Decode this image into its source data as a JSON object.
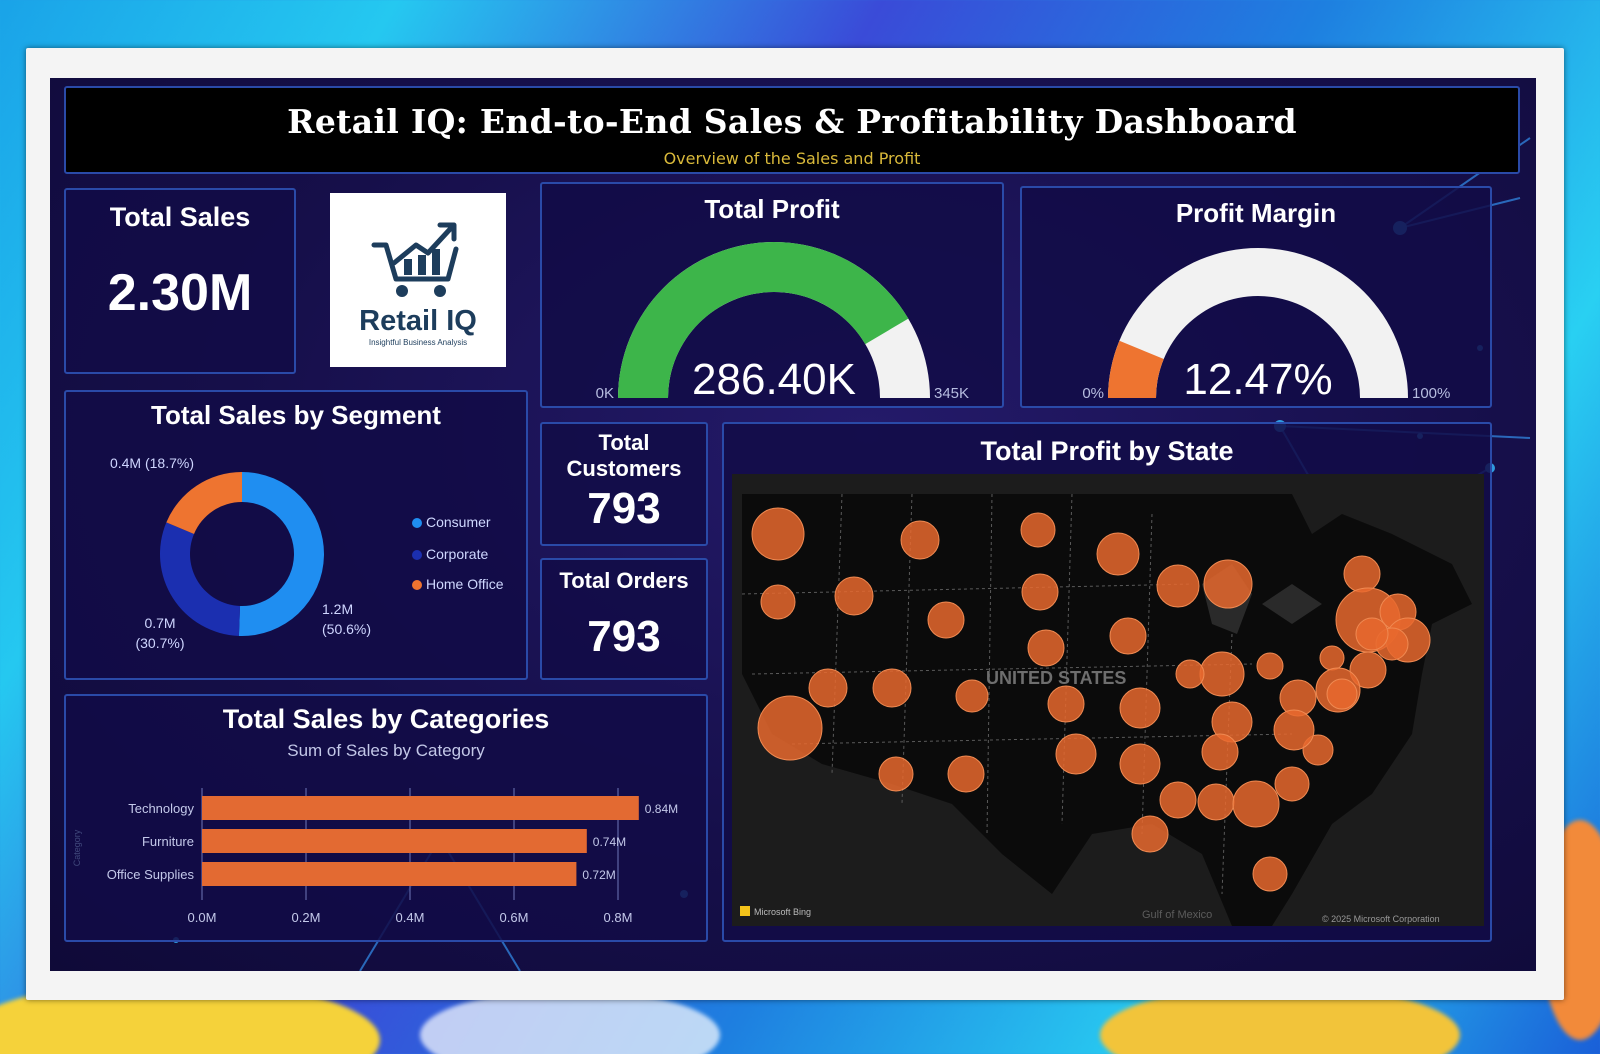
{
  "header": {
    "title": "Retail IQ: End-to-End Sales & Profitability Dashboard",
    "subtitle": "Overview of the Sales and Profit"
  },
  "logo": {
    "name": "Retail IQ",
    "tagline": "Insightful Business Analysis"
  },
  "kpis": {
    "total_sales": {
      "label": "Total Sales",
      "value": "2.30M"
    },
    "total_customers": {
      "label_line1": "Total",
      "label_line2": "Customers",
      "value": "793"
    },
    "total_orders": {
      "label": "Total Orders",
      "value": "793"
    }
  },
  "map": {
    "title": "Total Profit by State",
    "country_label": "UNITED STATES",
    "attribution_left": "Microsoft Bing",
    "attribution_right": "© 2025 Microsoft Corporation",
    "gulf_label": "Gulf of Mexico",
    "bubble_color": "#e8692e"
  },
  "colors": {
    "consumer": "#1f8ef1",
    "corporate": "#1b2fb0",
    "home_office": "#ee7430",
    "gauge_green": "#3db54a",
    "bar_orange": "#e36a32"
  },
  "chart_data": [
    {
      "type": "gauge",
      "title": "Total Profit",
      "value": 286400,
      "value_label": "286.40K",
      "min": 0,
      "max": 345000,
      "min_label": "0K",
      "max_label": "345K"
    },
    {
      "type": "gauge",
      "title": "Profit Margin",
      "value": 12.47,
      "value_label": "12.47%",
      "min": 0,
      "max": 100,
      "min_label": "0%",
      "max_label": "100%"
    },
    {
      "type": "pie",
      "title": "Total Sales by Segment",
      "donut": true,
      "categories": [
        "Consumer",
        "Corporate",
        "Home Office"
      ],
      "values": [
        1.2,
        0.7,
        0.4
      ],
      "percents": [
        50.6,
        30.7,
        18.7
      ],
      "data_labels": [
        "1.2M",
        "0.7M",
        "0.4M"
      ],
      "percent_labels": [
        "(50.6%)",
        "(30.7%)",
        "(18.7%)"
      ],
      "legend_position": "right"
    },
    {
      "type": "bar",
      "orientation": "horizontal",
      "title": "Total Sales by Categories",
      "subtitle": "Sum of Sales by Category",
      "categories": [
        "Technology",
        "Furniture",
        "Office Supplies"
      ],
      "values": [
        0.84,
        0.74,
        0.72
      ],
      "data_labels": [
        "0.84M",
        "0.74M",
        "0.72M"
      ],
      "xlim": [
        0,
        0.8
      ],
      "xticks": [
        "0.0M",
        "0.2M",
        "0.4M",
        "0.6M",
        "0.8M"
      ],
      "ylabel": "Category",
      "grid": true
    }
  ]
}
